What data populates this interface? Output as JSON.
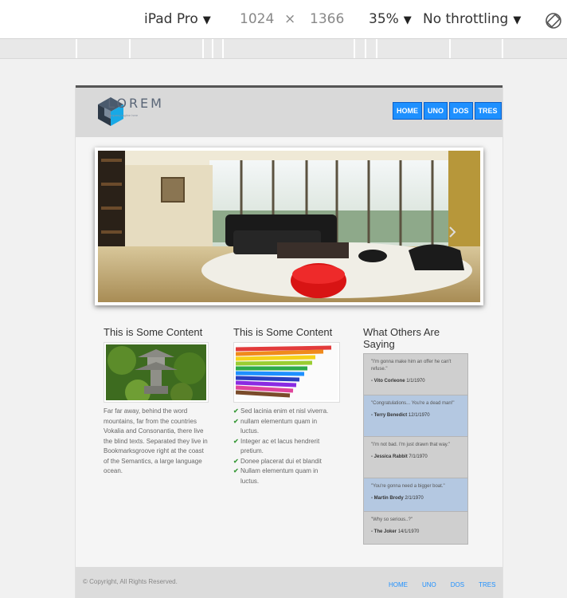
{
  "devtools": {
    "device": "iPad Pro",
    "width": "1024",
    "times": "×",
    "height": "1366",
    "zoom": "35%",
    "throttling": "No throttling"
  },
  "site": {
    "logo_word": "LOREM",
    "logo_tagline": "company tagline here",
    "nav": [
      "HOME",
      "UNO",
      "DOS",
      "TRES"
    ]
  },
  "columns": [
    {
      "title": "This is Some Content",
      "image": "stone-lantern-photo",
      "text": "Far far away, behind the word mountains, far from the countries Vokalia and Consonantia, there live the blind texts. Separated they live in Bookmarksgroove right at the coast of the Semantics, a large language ocean."
    },
    {
      "title": "This is Some Content",
      "image": "colored-pencils-photo",
      "items": [
        "Sed lacinia enim et nisl viverra.",
        "nullam elementum quam in luctus.",
        "Integer ac et lacus hendrerit pretium.",
        "Donee placerat dui et blandit",
        "Nullam elementum quam in luctus."
      ]
    }
  ],
  "testimonials": {
    "title": "What Others Are Saying",
    "items": [
      {
        "quote": "\"I'm gonna make him an offer he can't refuse.\"",
        "author": "- Vito Corleone",
        "date": "1/1/1970"
      },
      {
        "quote": "\"Congratulations... You're a dead man!\"",
        "author": "- Terry Benedict",
        "date": "12/1/1970"
      },
      {
        "quote": "\"I'm not bad. I'm just drawn that way.\"",
        "author": "- Jessica Rabbit",
        "date": "7/1/1970"
      },
      {
        "quote": "\"You're gonna need a bigger boat.\"",
        "author": "- Martin Brody",
        "date": "2/1/1970"
      },
      {
        "quote": "\"Why so serious..?\"",
        "author": "- The Joker",
        "date": "14/1/1970"
      }
    ]
  },
  "footer": {
    "copyright": "© Copyright, All Rights Reserved.",
    "nav": [
      "HOME",
      "UNO",
      "DOS",
      "TRES"
    ]
  },
  "colors": {
    "accent": "#1e90ff",
    "testimonial_alt": "#b4c8e1",
    "testimonial_plain": "#cfcfcf"
  }
}
